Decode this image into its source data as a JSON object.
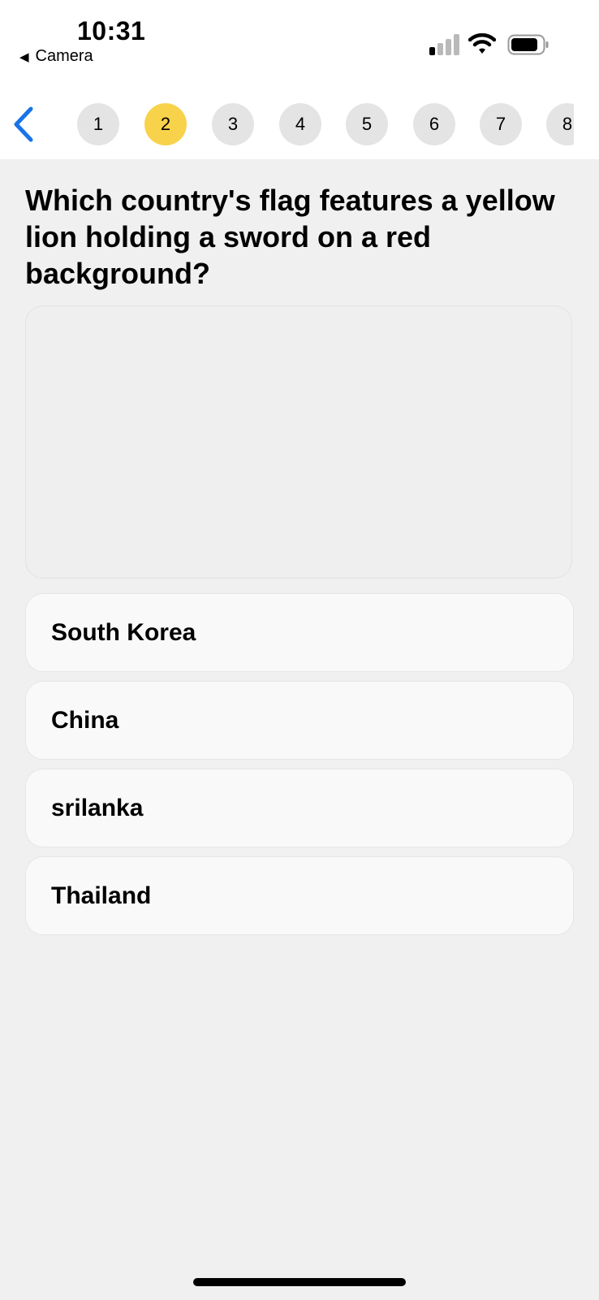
{
  "status_bar": {
    "time": "10:31",
    "back_app_label": "Camera",
    "icons": [
      "signal-icon",
      "wifi-icon",
      "battery-icon"
    ]
  },
  "nav": {
    "back_icon": "chevron-left-icon",
    "accent_color": "#1a73e8",
    "active_color": "#f8d24a",
    "steps": [
      {
        "label": "1",
        "active": false
      },
      {
        "label": "2",
        "active": true
      },
      {
        "label": "3",
        "active": false
      },
      {
        "label": "4",
        "active": false
      },
      {
        "label": "5",
        "active": false
      },
      {
        "label": "6",
        "active": false
      },
      {
        "label": "7",
        "active": false
      },
      {
        "label": "8",
        "active": false
      }
    ]
  },
  "question": {
    "text": "Which country's flag features a yellow lion holding a sword on a red background?"
  },
  "options": [
    {
      "label": "South Korea"
    },
    {
      "label": "China"
    },
    {
      "label": "srilanka"
    },
    {
      "label": "Thailand"
    }
  ]
}
